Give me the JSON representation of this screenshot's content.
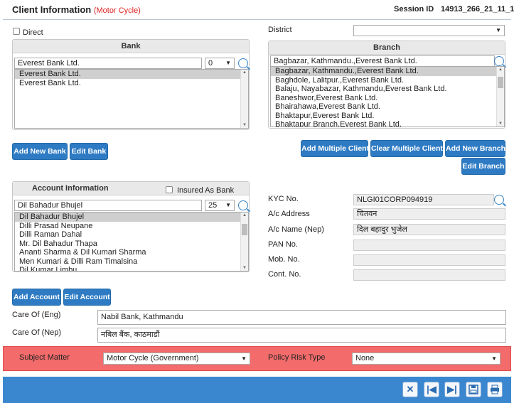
{
  "header": {
    "title": "Client Information",
    "subtitle": "(Motor Cycle)",
    "session_label": "Session ID",
    "session_value": "14913_266_21_11_1"
  },
  "direct": {
    "label": "Direct",
    "checked": false
  },
  "bank_panel": {
    "title": "Bank",
    "search_value": "Everest Bank Ltd.",
    "count_value": "0",
    "items": [
      "Everest Bank Ltd.",
      "Everest Bank Ltd."
    ],
    "selected_index": 0
  },
  "district": {
    "label": "District",
    "value": ""
  },
  "branch_panel": {
    "title": "Branch",
    "search_value": "Bagbazar, Kathmandu.,Everest Bank Ltd.",
    "items": [
      "Bagbazar, Kathmandu.,Everest Bank Ltd.",
      "Baghdole, Lalitpur.,Everest Bank Ltd.",
      "Balaju, Nayabazar, Kathmandu,Everest Bank Ltd.",
      "Baneshwor,Everest Bank Ltd.",
      "Bhairahawa,Everest Bank Ltd.",
      "Bhaktapur,Everest Bank Ltd.",
      "Bhaktapur Branch,Everest Bank Ltd."
    ],
    "selected_index": 0
  },
  "buttons": {
    "add_new_bank": "Add New Bank",
    "edit_bank": "Edit Bank",
    "add_multiple_client": "Add Multiple Client",
    "clear_multiple_client": "Clear Multiple Client",
    "add_new_branch": "Add New Branch",
    "edit_branch": "Edit Branch",
    "add_account": "Add Account",
    "edit_account": "Edit Account"
  },
  "account_panel": {
    "title": "Account Information",
    "insured_as_bank_label": "Insured As Bank",
    "search_value": "Dil Bahadur Bhujel",
    "count_value": "25",
    "items": [
      "Dil Bahadur Bhujel",
      "Dilli Prasad Neupane",
      "Dilli Raman Dahal",
      "Mr. Dil Bahadur Thapa",
      "Ananti Sharma & Dil Kumari Sharma",
      "Men Kumari & Dilli Ram Timalsina",
      "Dil Kumar Limbu"
    ],
    "selected_index": 0
  },
  "kyc": {
    "kyc_label": "KYC No.",
    "kyc_value": "NLGI01CORP094919",
    "address_label": "A/c Address",
    "address_value": "चितवन",
    "name_nep_label": "A/c Name (Nep)",
    "name_nep_value": "दिल बहादुर भुजेल",
    "pan_label": "PAN No.",
    "pan_value": "",
    "mob_label": "Mob. No.",
    "mob_value": "",
    "cont_label": "Cont. No.",
    "cont_value": ""
  },
  "care_of": {
    "eng_label": "Care Of (Eng)",
    "eng_value": "Nabil Bank, Kathmandu",
    "nep_label": "Care Of (Nep)",
    "nep_value": "नबिल बैंक, काठमाडौं"
  },
  "subject": {
    "label": "Subject Matter",
    "value": "Motor Cycle (Government)",
    "risk_label": "Policy Risk Type",
    "risk_value": "None"
  },
  "colors": {
    "accent": "#2e7bc4",
    "alert_bar": "#f36b6b",
    "footer": "#3a87d0"
  }
}
